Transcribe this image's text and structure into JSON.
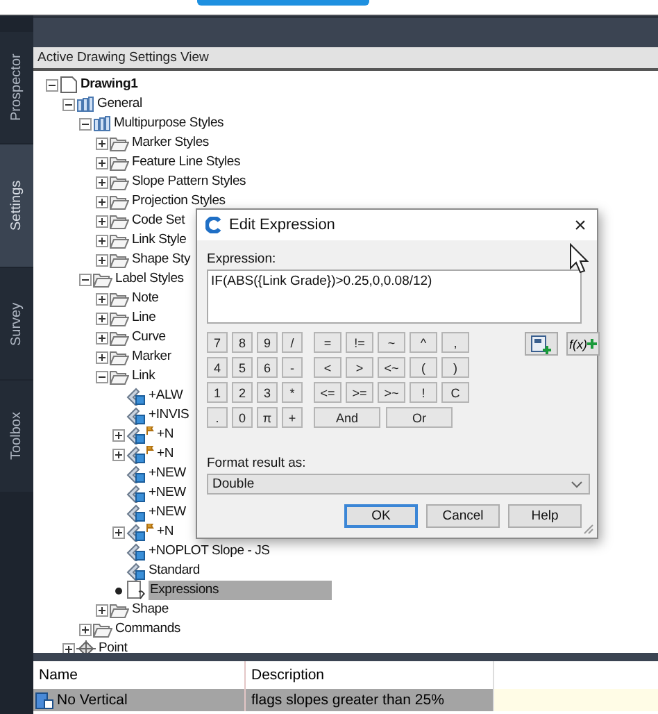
{
  "side_tabs": [
    {
      "label": "Prospector",
      "selected": false
    },
    {
      "label": "Settings",
      "selected": true
    },
    {
      "label": "Survey",
      "selected": false
    },
    {
      "label": "Toolbox",
      "selected": false
    }
  ],
  "panel": {
    "title": "Active Drawing Settings View"
  },
  "tree": [
    {
      "label": "Drawing1",
      "kind": "drawing",
      "expanded": true,
      "selected": false,
      "children": [
        {
          "label": "General",
          "kind": "general",
          "expanded": true,
          "selected": false,
          "children": [
            {
              "label": "Multipurpose Styles",
              "kind": "general",
              "expanded": true,
              "selected": false,
              "children": [
                {
                  "label": "Marker Styles",
                  "kind": "folder",
                  "expanded": false,
                  "selected": false
                },
                {
                  "label": "Feature Line Styles",
                  "kind": "folder",
                  "expanded": false,
                  "selected": false
                },
                {
                  "label": "Slope Pattern Styles",
                  "kind": "folder",
                  "expanded": false,
                  "selected": false
                },
                {
                  "label": "Projection Styles",
                  "kind": "folder",
                  "expanded": false,
                  "selected": false
                },
                {
                  "label": "Code Set",
                  "kind": "folder",
                  "expanded": false,
                  "selected": false
                },
                {
                  "label": "Link Style",
                  "kind": "folder",
                  "expanded": false,
                  "selected": false
                },
                {
                  "label": "Shape Sty",
                  "kind": "folder",
                  "expanded": false,
                  "selected": false
                }
              ]
            },
            {
              "label": "Label Styles",
              "kind": "folder",
              "expanded": true,
              "selected": false,
              "children": [
                {
                  "label": "Note",
                  "kind": "folder",
                  "expanded": false,
                  "selected": false
                },
                {
                  "label": "Line",
                  "kind": "folder",
                  "expanded": false,
                  "selected": false
                },
                {
                  "label": "Curve",
                  "kind": "folder",
                  "expanded": false,
                  "selected": false
                },
                {
                  "label": "Marker",
                  "kind": "folder",
                  "expanded": false,
                  "selected": false
                },
                {
                  "label": "Link",
                  "kind": "folder",
                  "expanded": true,
                  "selected": false,
                  "children": [
                    {
                      "label": "+ALW",
                      "kind": "style",
                      "selected": false
                    },
                    {
                      "label": "+INVIS",
                      "kind": "style",
                      "selected": false
                    },
                    {
                      "label": "+N",
                      "kind": "style-flag",
                      "expanded": false,
                      "selected": false
                    },
                    {
                      "label": "+N",
                      "kind": "style-flag",
                      "expanded": false,
                      "selected": false
                    },
                    {
                      "label": "+NEW",
                      "kind": "style",
                      "selected": false
                    },
                    {
                      "label": "+NEW",
                      "kind": "style",
                      "selected": false
                    },
                    {
                      "label": "+NEW",
                      "kind": "style",
                      "selected": false
                    },
                    {
                      "label": "+N",
                      "kind": "style-flag",
                      "expanded": false,
                      "selected": false
                    },
                    {
                      "label": "+NOPLOT Slope - JS",
                      "kind": "style",
                      "selected": false
                    },
                    {
                      "label": "Standard",
                      "kind": "style",
                      "selected": false
                    },
                    {
                      "label": "Expressions",
                      "kind": "expressions",
                      "selected": true
                    }
                  ]
                },
                {
                  "label": "Shape",
                  "kind": "folder",
                  "expanded": false,
                  "selected": false
                }
              ]
            },
            {
              "label": "Commands",
              "kind": "folder",
              "expanded": false,
              "selected": false
            }
          ]
        },
        {
          "label": "Point",
          "kind": "point",
          "expanded": false,
          "selected": false
        }
      ]
    }
  ],
  "grid": {
    "columns": [
      "Name",
      "Description"
    ],
    "rows": [
      {
        "name": "No Vertical",
        "description": "flags slopes greater than 25%",
        "selected": true
      }
    ]
  },
  "dialog": {
    "title": "Edit Expression",
    "close": "×",
    "expression_label": "Expression:",
    "expression": "IF(ABS({Link Grade})>0.25,0,0.08/12)",
    "number_keys": [
      "7",
      "8",
      "9",
      "/",
      "4",
      "5",
      "6",
      "-",
      "1",
      "2",
      "3",
      "*",
      ".",
      "0",
      "π",
      "+"
    ],
    "operator_keys": [
      "=",
      "!=",
      "~",
      "^",
      ",",
      "<",
      ">",
      "<~",
      "(",
      ")",
      "<=",
      ">=",
      ">~",
      "!",
      "C"
    ],
    "wide_keys": [
      "And",
      "Or"
    ],
    "function_button": "f(x)",
    "format_label": "Format result as:",
    "format_value": "Double",
    "buttons": [
      {
        "label": "OK",
        "default": true
      },
      {
        "label": "Cancel",
        "default": false
      },
      {
        "label": "Help",
        "default": false
      }
    ]
  }
}
